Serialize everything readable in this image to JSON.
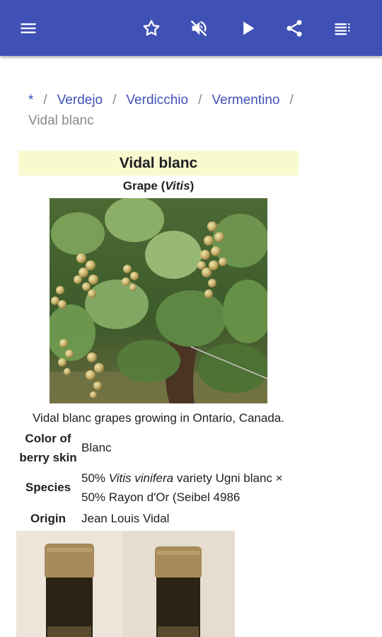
{
  "toolbar": {
    "menu_icon": "menu-icon",
    "actions": [
      "star-icon",
      "volume-off-icon",
      "play-icon",
      "share-icon",
      "list-icon"
    ]
  },
  "breadcrumb": {
    "items": [
      "*",
      "Verdejo",
      "Verdicchio",
      "Vermentino"
    ],
    "current": "Vidal blanc"
  },
  "infobox": {
    "title": "Vidal blanc",
    "subtitle_prefix": "Grape (",
    "subtitle_italic": "Vitis",
    "subtitle_suffix": ")",
    "caption": "Vidal blanc grapes growing in Ontario, Canada.",
    "rows": [
      {
        "label": "Color of berry skin",
        "value": "Blanc"
      },
      {
        "label": "Species",
        "value_prefix": "50% ",
        "value_italic": "Vitis vinifera",
        "value_suffix": " variety Ugni blanc × 50% Rayon d'Or (Seibel 4986"
      },
      {
        "label": "Origin",
        "value": "Jean Louis Vidal"
      }
    ]
  },
  "colors": {
    "appbar": "#3f51b5",
    "link": "#3f51b5",
    "title_bg": "#f9f9cf"
  }
}
